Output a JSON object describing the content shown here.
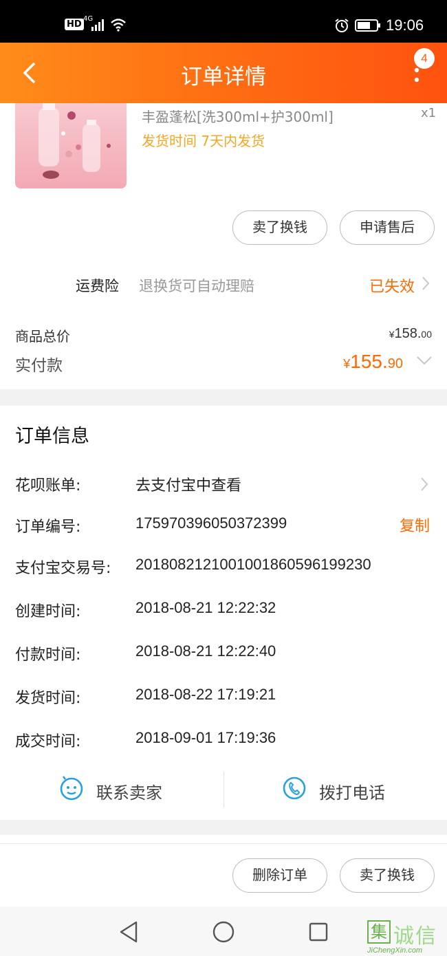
{
  "status_bar": {
    "hd": "HD",
    "network": "4G",
    "time": "19:06"
  },
  "navbar": {
    "title": "订单详情",
    "badge": "4"
  },
  "product": {
    "name": "丰盈蓬松[洗300ml+护300ml]",
    "qty": "x1",
    "ship_time": "发货时间  7天内发货"
  },
  "actions_top": {
    "sell": "卖了换钱",
    "after_sale": "申请售后"
  },
  "insurance": {
    "label": "运费险",
    "desc": "退换货可自动理赔",
    "status": "已失效"
  },
  "totals": {
    "total_label": "商品总价",
    "total_currency": "¥",
    "total_int": "158.",
    "total_dec": "00",
    "paid_label": "实付款",
    "paid_currency": "¥",
    "paid_int": "155.",
    "paid_dec": "90"
  },
  "order_info": {
    "title": "订单信息",
    "rows": [
      {
        "key": "花呗账单:",
        "value": "去支付宝中查看"
      },
      {
        "key": "订单编号:",
        "value": "175970396050372399",
        "action": "复制"
      },
      {
        "key": "支付宝交易号:",
        "value": "2018082121001001860596199230"
      },
      {
        "key": "创建时间:",
        "value": "2018-08-21 12:22:32"
      },
      {
        "key": "付款时间:",
        "value": "2018-08-21 12:22:40"
      },
      {
        "key": "发货时间:",
        "value": "2018-08-22 17:19:21"
      },
      {
        "key": "成交时间:",
        "value": "2018-09-01 17:19:36"
      }
    ]
  },
  "contact": {
    "seller": "联系卖家",
    "call": "拨打电话"
  },
  "actions_bottom": {
    "delete": "删除订单",
    "sell": "卖了换钱"
  },
  "watermark": {
    "mark": "集",
    "text": "诚信",
    "url": "JiChengXin.com"
  },
  "colors": {
    "accent": "#ff6a00",
    "nav_start": "#ff8c1a",
    "nav_end": "#ff5210",
    "ship_time": "#f5a623",
    "contact_icon": "#29a0e0"
  }
}
